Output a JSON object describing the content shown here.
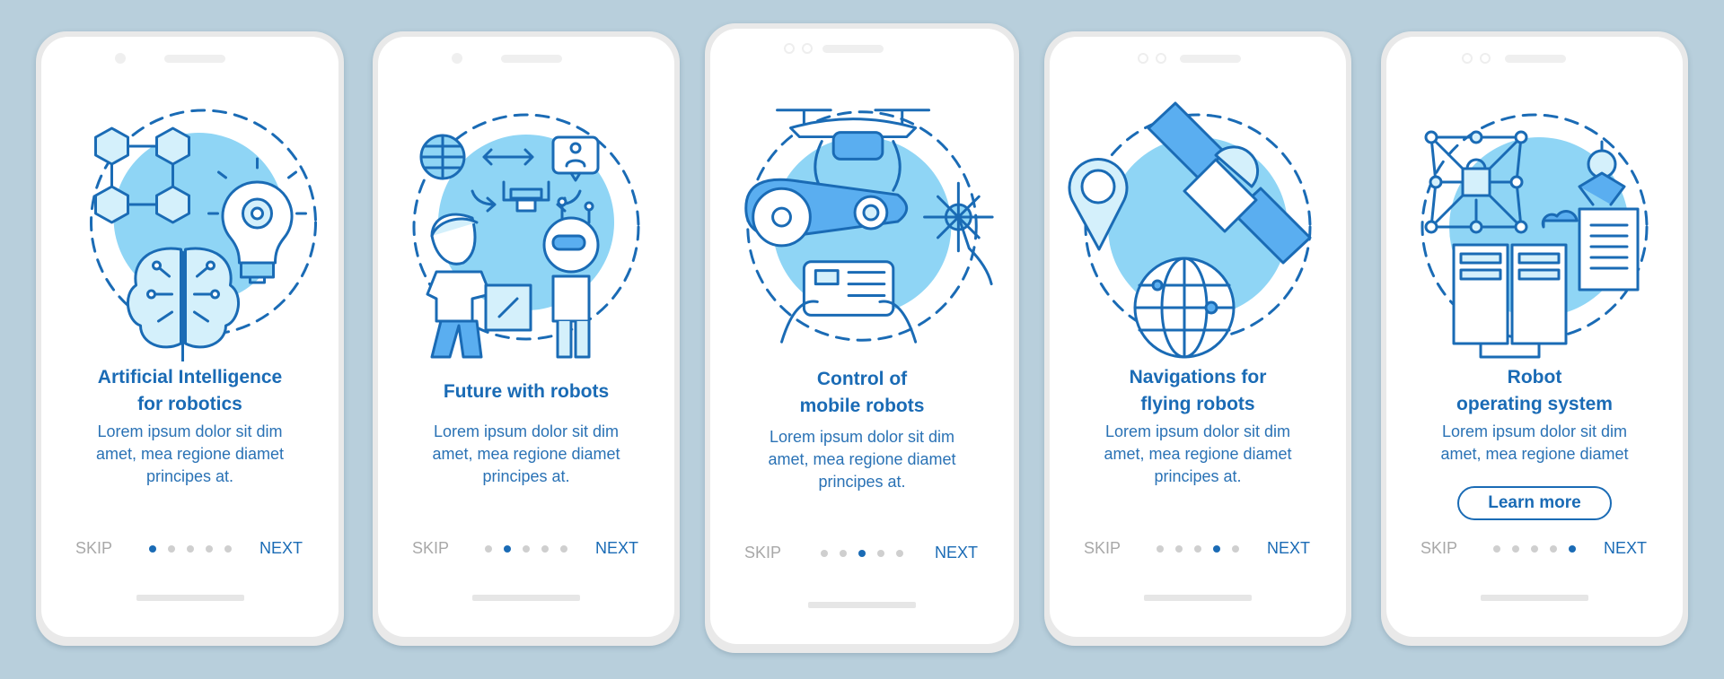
{
  "colors": {
    "background": "#b8cfdc",
    "accent": "#1a6bb5",
    "light_fill": "#8fd5f5",
    "inactive_dot": "#cfcfcf",
    "skip_text": "#a8a8a8"
  },
  "screens": [
    {
      "illustration": "ai-brain-lightbulb-blocks",
      "title_lines": [
        "Artificial Intelligence",
        "for robotics"
      ],
      "description_lines": [
        "Lorem ipsum dolor sit dim",
        "amet, mea regione diamet",
        "principes at."
      ],
      "skip_label": "SKIP",
      "next_label": "NEXT",
      "active_page": 1,
      "total_pages": 5
    },
    {
      "illustration": "human-robot-handover",
      "title_lines": [
        "Future with robots"
      ],
      "description_lines": [
        "Lorem ipsum dolor sit dim",
        "amet, mea regione diamet",
        "principes at."
      ],
      "skip_label": "SKIP",
      "next_label": "NEXT",
      "active_page": 2,
      "total_pages": 5
    },
    {
      "illustration": "drone-gear-remote-control",
      "title_lines": [
        "Control of",
        "mobile robots"
      ],
      "description_lines": [
        "Lorem ipsum dolor sit dim",
        "amet, mea regione diamet",
        "principes at."
      ],
      "skip_label": "SKIP",
      "next_label": "NEXT",
      "active_page": 3,
      "total_pages": 5
    },
    {
      "illustration": "satellite-globe-location-pin",
      "title_lines": [
        "Navigations for",
        "flying robots"
      ],
      "description_lines": [
        "Lorem ipsum dolor sit dim",
        "amet, mea regione diamet",
        "principes at."
      ],
      "skip_label": "SKIP",
      "next_label": "NEXT",
      "active_page": 4,
      "total_pages": 5
    },
    {
      "illustration": "network-servers-robot-arm-document",
      "title_lines": [
        "Robot",
        "operating system"
      ],
      "description_lines": [
        "Lorem ipsum dolor sit dim",
        "amet, mea regione diamet"
      ],
      "button_label": "Learn more",
      "skip_label": "SKIP",
      "next_label": "NEXT",
      "active_page": 5,
      "total_pages": 5
    }
  ]
}
